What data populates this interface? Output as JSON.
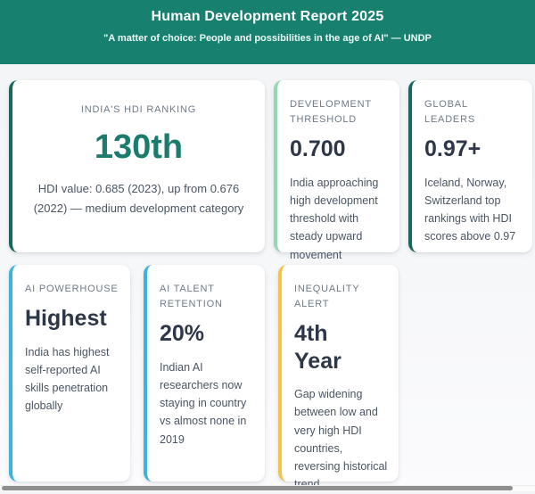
{
  "header": {
    "title": "Human Development Report 2025",
    "subtitle": "\"A matter of choice: People and possibilities in the age of AI\" — UNDP",
    "bg_color": "#17806F"
  },
  "cards": [
    {
      "label": "INDIA'S HDI RANKING",
      "value": "130th",
      "description": "HDI value: 0.685 (2023), up from 0.676 (2022) — medium development category",
      "accent_color": "#17685D",
      "value_color": "#1B7C6E"
    },
    {
      "label": "DEVELOPMENT THRESHOLD",
      "value": "0.700",
      "description": "India approaching high development threshold with steady upward movement",
      "accent_color": "#95D6B4",
      "value_color": "#2D3748"
    },
    {
      "label": "GLOBAL LEADERS",
      "value": "0.97+",
      "description": "Iceland, Norway, Switzerland top rankings with HDI scores above 0.97",
      "accent_color": "#17685D",
      "value_color": "#2D3748"
    },
    {
      "label": "AI POWERHOUSE",
      "value": "Highest",
      "description": "India has highest self-reported AI skills penetration globally",
      "accent_color": "#3BB3DA",
      "value_color": "#2D3748"
    },
    {
      "label": "AI TALENT RETENTION",
      "value": "20%",
      "description": "Indian AI researchers now staying in country vs almost none in 2019",
      "accent_color": "#3BB3DA",
      "value_color": "#2D3748"
    },
    {
      "label": "INEQUALITY ALERT",
      "value": "4th Year",
      "description": "Gap widening between low and very high HDI countries, reversing historical trend",
      "accent_color": "#F6C24A",
      "value_color": "#2D3748"
    }
  ],
  "scrollbar": {
    "orientation": "horizontal",
    "thumb_color": "#8F8F8F"
  }
}
